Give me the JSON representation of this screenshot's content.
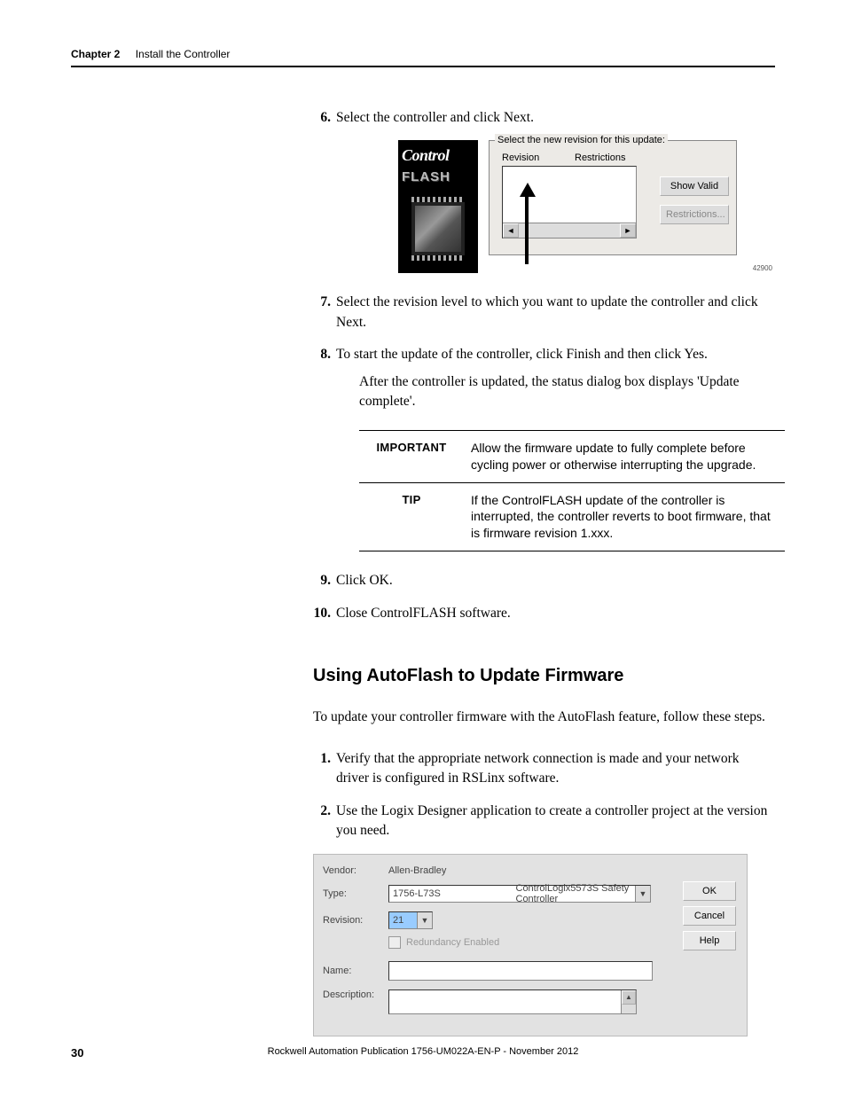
{
  "header": {
    "chapter": "Chapter 2",
    "title": "Install the Controller"
  },
  "steps_a": {
    "s6": {
      "num": "6.",
      "text": "Select the controller and click Next."
    },
    "s7": {
      "num": "7.",
      "text": "Select the revision level to which you want to update the controller and click Next."
    },
    "s8": {
      "num": "8.",
      "text": "To start the update of the controller, click Finish and then click Yes.",
      "after": "After the controller is updated, the status dialog box displays 'Update complete'."
    },
    "s9": {
      "num": "9.",
      "text": "Click OK."
    },
    "s10": {
      "num": "10.",
      "text": "Close ControlFLASH software."
    }
  },
  "shot1": {
    "logo_top": "Control",
    "logo_bottom": "FLASH",
    "legend": "Select the new revision for this update:",
    "col1": "Revision",
    "col2": "Restrictions",
    "btn_showvalid": "Show Valid",
    "btn_restrictions": "Restrictions...",
    "img_id": "42900"
  },
  "notes": {
    "imp_label": "IMPORTANT",
    "imp_text": "Allow the firmware update to fully complete before cycling power or otherwise interrupting the upgrade.",
    "tip_label": "TIP",
    "tip_text": "If the ControlFLASH update of the controller is interrupted, the controller reverts to boot firmware, that is firmware revision 1.xxx."
  },
  "section": {
    "heading": "Using AutoFlash to Update Firmware",
    "intro": "To update your controller firmware with the AutoFlash feature, follow these steps."
  },
  "steps_b": {
    "s1": {
      "num": "1.",
      "text": "Verify that the appropriate network connection is made and your network driver is configured in RSLinx software."
    },
    "s2": {
      "num": "2.",
      "text": "Use the Logix Designer application to create a controller project at the version you need."
    }
  },
  "shot2": {
    "vendor_label": "Vendor:",
    "vendor_value": "Allen-Bradley",
    "type_label": "Type:",
    "type_code": "1756-L73S",
    "type_desc": "ControlLogix5573S Safety Controller",
    "rev_label": "Revision:",
    "rev_value": "21",
    "redund_label": "Redundancy Enabled",
    "name_label": "Name:",
    "desc_label": "Description:",
    "btn_ok": "OK",
    "btn_cancel": "Cancel",
    "btn_help": "Help"
  },
  "footer": {
    "page": "30",
    "pub": "Rockwell Automation Publication 1756-UM022A-EN-P - November 2012"
  }
}
